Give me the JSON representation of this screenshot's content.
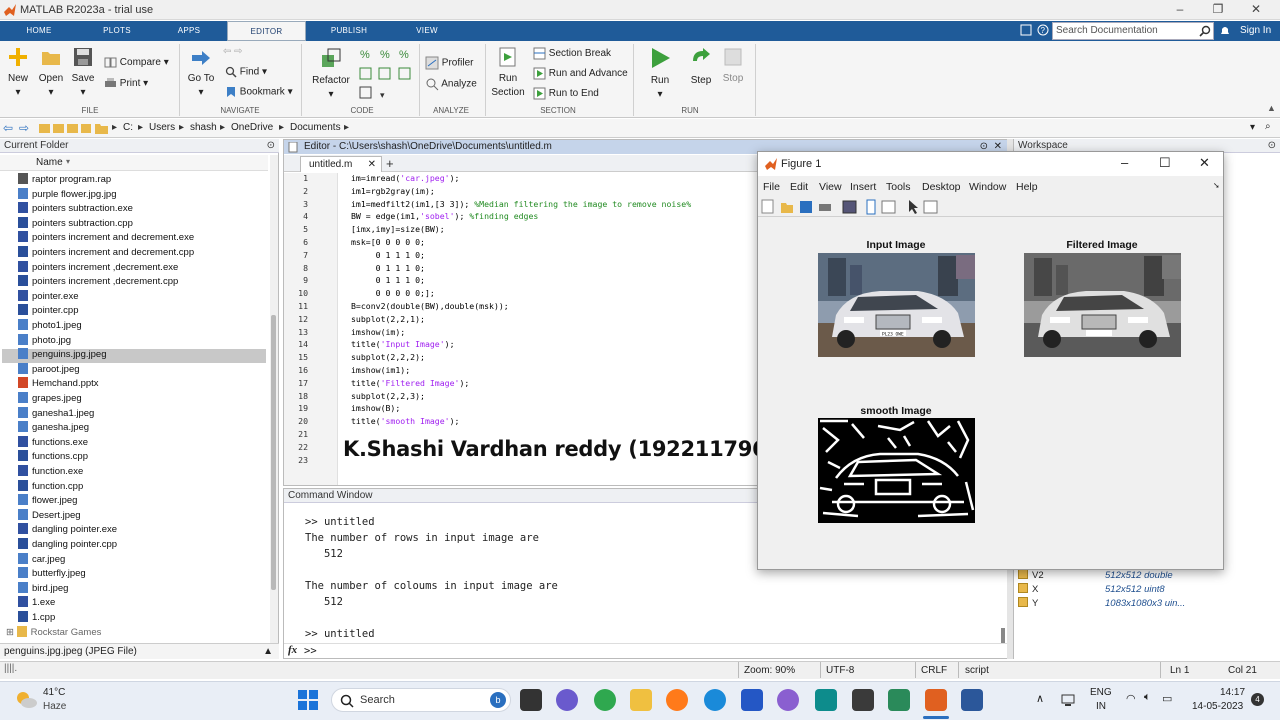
{
  "window": {
    "title": "MATLAB R2023a - trial use"
  },
  "tabs": [
    "HOME",
    "PLOTS",
    "APPS",
    "EDITOR",
    "PUBLISH",
    "VIEW"
  ],
  "search": {
    "placeholder": "Search Documentation"
  },
  "sign_in": "Sign In",
  "toolstrip": {
    "file": {
      "title": "FILE",
      "new": "New",
      "open": "Open",
      "save": "Save",
      "compare": "Compare",
      "print": "Print"
    },
    "navigate": {
      "title": "NAVIGATE",
      "goto": "Go To",
      "find": "Find",
      "bookmark": "Bookmark"
    },
    "code": {
      "title": "CODE",
      "refactor": "Refactor"
    },
    "analyze": {
      "title": "ANALYZE",
      "profiler": "Profiler",
      "analyze": "Analyze"
    },
    "section": {
      "title": "SECTION",
      "run_section": "Run Section",
      "section_break": "Section Break",
      "run_and_advance": "Run and Advance",
      "run_to_end": "Run to End"
    },
    "run": {
      "title": "RUN",
      "run": "Run",
      "step": "Step",
      "stop": "Stop"
    }
  },
  "address": {
    "drive": "C:",
    "parts": [
      "Users",
      "shash",
      "OneDrive",
      "Documents"
    ]
  },
  "current_folder": {
    "title": "Current Folder",
    "column": "Name",
    "files": [
      "raptor program.rap",
      "purple flower.jpg.jpg",
      "pointers subtraction.exe",
      "pointers subtraction.cpp",
      "pointers increment and decrement.exe",
      "pointers increment and decrement.cpp",
      "pointers increment ,decrement.exe",
      "pointers increment ,decrement.cpp",
      "pointer.exe",
      "pointer.cpp",
      "photo1.jpeg",
      "photo.jpg",
      "penguins.jpg.jpeg",
      "paroot.jpeg",
      "Hemchand.pptx",
      "grapes.jpeg",
      "ganesha1.jpeg",
      "ganesha.jpeg",
      "functions.exe",
      "functions.cpp",
      "function.exe",
      "function.cpp",
      "flower.jpeg",
      "Desert.jpeg",
      "dangling pointer.exe",
      "dangling pointer.cpp",
      "car.jpeg",
      "butterfly.jpeg",
      "bird.jpeg",
      "1.exe",
      "1.cpp",
      "Rockstar Games"
    ],
    "selected": "penguins.jpg.jpeg",
    "details": "penguins.jpg.jpeg  (JPEG File)"
  },
  "editor": {
    "title": "Editor - C:\\Users\\shash\\OneDrive\\Documents\\untitled.m",
    "tab": "untitled.m",
    "lines": [
      [
        "im=imread(",
        "'car.jpeg'",
        ");"
      ],
      [
        "im1=rgb2gray(im);"
      ],
      [
        "im1=medfilt2(im1,[3 3]); ",
        "",
        "%Median filtering the image to remove noise%"
      ],
      [
        "BW = edge(im1,",
        "'sobel'",
        "); ",
        "%finding edges"
      ],
      [
        "[imx,imy]=size(BW);"
      ],
      [
        "msk=[0 0 0 0 0;"
      ],
      [
        "     0 1 1 1 0;"
      ],
      [
        "     0 1 1 1 0;"
      ],
      [
        "     0 1 1 1 0;"
      ],
      [
        "     0 0 0 0 0;];"
      ],
      [
        "B=conv2(double(BW),double(msk));"
      ],
      [
        "subplot(2,2,1);"
      ],
      [
        "imshow(im);"
      ],
      [
        "title(",
        "'Input Image'",
        ");"
      ],
      [
        "subplot(2,2,2);"
      ],
      [
        "imshow(im1);"
      ],
      [
        "title(",
        "'Filtered Image'",
        ");"
      ],
      [
        "subplot(2,2,3);"
      ],
      [
        "imshow(B);"
      ],
      [
        "title(",
        "'smooth Image'",
        ");"
      ],
      [
        ""
      ],
      [
        ""
      ],
      [
        ""
      ]
    ],
    "signature": "K.Shashi Vardhan reddy (192211796)"
  },
  "command_window": {
    "title": "Command Window",
    "lines": [
      ">> untitled",
      "The number of rows in input image are",
      "   512",
      "",
      "The number of coloums in input image are",
      "   512",
      "",
      ">> untitled"
    ],
    "prompt": ">>",
    "fx": "fx"
  },
  "workspace": {
    "title": "Workspace",
    "vars": [
      {
        "name": "V2",
        "value": "512x512 double"
      },
      {
        "name": "X",
        "value": "512x512 uint8"
      },
      {
        "name": "Y",
        "value": "1083x1080x3 uin..."
      }
    ]
  },
  "figure": {
    "title": "Figure 1",
    "menu": [
      "File",
      "Edit",
      "View",
      "Insert",
      "Tools",
      "Desktop",
      "Window",
      "Help"
    ],
    "axes_titles": [
      "Input Image",
      "Filtered Image",
      "smooth Image"
    ],
    "car_plate": "PL23 OWE"
  },
  "status": {
    "zoom": "Zoom: 90%",
    "encoding": "UTF-8",
    "eol": "CRLF",
    "mode": "script",
    "ln": "Ln 1",
    "col": "Col 21"
  },
  "taskbar": {
    "weather_temp": "41°C",
    "weather_desc": "Haze",
    "search": "Search",
    "lang1": "ENG",
    "lang2": "IN",
    "time": "14:17",
    "date": "14-05-2023",
    "badge": "4"
  },
  "colors": {
    "tab_bar": "#1f5b99",
    "accent": "#2a6fbf",
    "string": "#a020f0",
    "comment": "#228b22"
  }
}
